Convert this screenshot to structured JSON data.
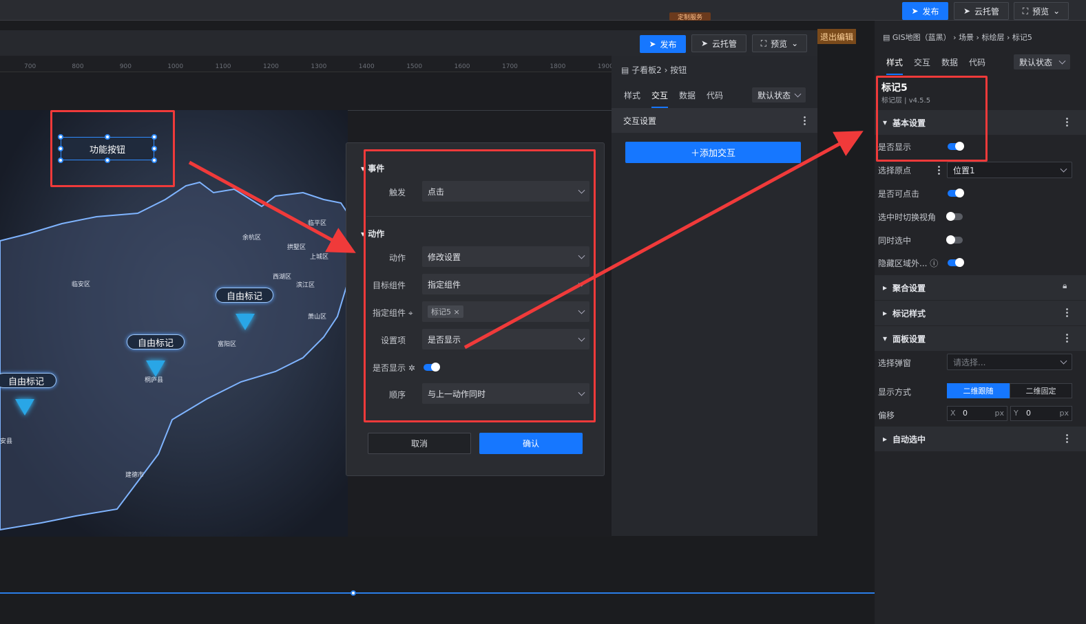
{
  "topbar": {
    "publish": "发布",
    "cloud": "云托管",
    "preview": "预览",
    "exit_edit": "退出编辑",
    "hidden_tag": "定制服务"
  },
  "inner_toolbar": {
    "publish": "发布",
    "cloud": "云托管",
    "preview": "预览"
  },
  "ruler": {
    "ticks": [
      "700",
      "800",
      "900",
      "1000",
      "1100",
      "1200",
      "1300",
      "1400",
      "1500",
      "1600",
      "1700",
      "1800",
      "1900"
    ]
  },
  "canvas": {
    "function_button": "功能按钮",
    "markers": [
      "自由标记",
      "自由标记",
      "自由标记"
    ],
    "places": [
      "临平区",
      "余杭区",
      "拱墅区",
      "上城区",
      "西湖区",
      "滨江区",
      "萧山区",
      "富阳区",
      "桐庐县",
      "临安区",
      "建德市",
      "安县"
    ]
  },
  "mid_panel": {
    "breadcrumb": [
      "子看板2",
      "按钮"
    ],
    "tabs": [
      "样式",
      "交互",
      "数据",
      "代码"
    ],
    "state_select": "默认状态",
    "section": "交互设置",
    "add_button": "添加交互"
  },
  "dialog": {
    "event_title": "事件",
    "trigger_label": "触发",
    "trigger_value": "点击",
    "action_title": "动作",
    "action_label": "动作",
    "action_value": "修改设置",
    "target_label": "目标组件",
    "target_value": "指定组件",
    "specified_label": "指定组件",
    "specified_tag": "标记5",
    "setting_label": "设置项",
    "setting_value": "是否显示",
    "show_label": "是否显示",
    "show_value": true,
    "order_label": "顺序",
    "order_value": "与上一动作同时",
    "cancel": "取消",
    "confirm": "确认"
  },
  "right_panel": {
    "breadcrumb": [
      "GIS地图（蓝黑）",
      "场景",
      "标绘层",
      "标记5"
    ],
    "tabs": [
      "样式",
      "交互",
      "数据",
      "代码"
    ],
    "state_select": "默认状态",
    "title": "标记5",
    "subtitle": "标记层 | v4.5.5",
    "basic_section": "基本设置",
    "is_show": "是否显示",
    "is_show_value": true,
    "origin_label": "选择原点",
    "origin_value": "位置1",
    "clickable": "是否可点击",
    "clickable_value": true,
    "switch_view": "选中时切换视角",
    "switch_view_value": false,
    "sync_select": "同时选中",
    "sync_select_value": false,
    "hide_outside": "隐藏区域外...",
    "hide_outside_value": true,
    "aggregate_section": "聚合设置",
    "marker_style_section": "标记样式",
    "panel_section": "面板设置",
    "popup_label": "选择弹窗",
    "popup_placeholder": "请选择...",
    "display_label": "显示方式",
    "display_follow": "二维跟随",
    "display_fixed": "二维固定",
    "offset_label": "偏移",
    "offset_x_label": "X",
    "offset_x": "0",
    "offset_y_label": "Y",
    "offset_y": "0",
    "unit": "px",
    "auto_select_section": "自动选中"
  },
  "colors": {
    "accent": "#1677ff",
    "highlight": "#f03a3a"
  }
}
